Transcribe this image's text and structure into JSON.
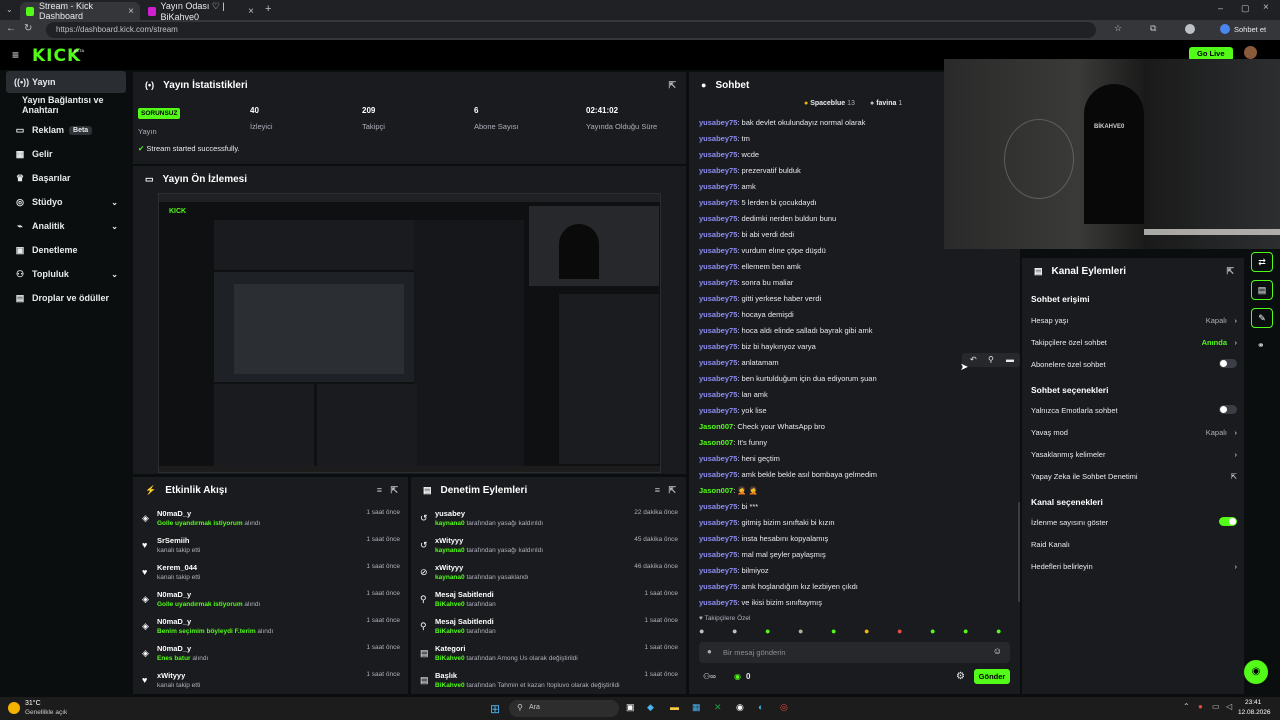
{
  "browser": {
    "tabs": [
      {
        "title": "Stream - Kick Dashboard",
        "color": "#53fc18"
      },
      {
        "title": "Yayın Odası ♡ | BiKahve0",
        "color": "#d01fd1"
      }
    ],
    "url": "https://dashboard.kick.com/stream",
    "profile_label": "Sohbet et"
  },
  "app": {
    "logo": "KICK",
    "logo_sup": "BETA",
    "go_live": "Go Live"
  },
  "sidebar": {
    "items": [
      {
        "label": "Yayın",
        "icon": "broadcast-icon"
      },
      {
        "label": "Yayın Bağlantısı ve Anahtarı",
        "icon": ""
      },
      {
        "label": "Reklam",
        "badge": "Beta",
        "icon": "ad-icon"
      },
      {
        "label": "Gelir",
        "icon": "money-icon"
      },
      {
        "label": "Başarılar",
        "icon": "trophy-icon"
      },
      {
        "label": "Stüdyo",
        "icon": "studio-icon"
      },
      {
        "label": "Analitik",
        "icon": "analytics-icon"
      },
      {
        "label": "Denetleme",
        "icon": "moderation-icon"
      },
      {
        "label": "Topluluk",
        "icon": "community-icon"
      },
      {
        "label": "Droplar ve ödüller",
        "icon": "drops-icon"
      }
    ]
  },
  "stats": {
    "title": "Yayın İstatistikleri",
    "status_badge": "SORUNSUZ",
    "status_label": "Yayın",
    "items": [
      {
        "value": "40",
        "label": "İzleyici"
      },
      {
        "value": "209",
        "label": "Takipçi"
      },
      {
        "value": "6",
        "label": "Abone Sayısı"
      },
      {
        "value": "02:41:02",
        "label": "Yayında Olduğu Süre"
      }
    ],
    "success": "Stream started successfully."
  },
  "preview": {
    "title": "Yayın Ön İzlemesi"
  },
  "activity": {
    "title": "Etkinlik Akışı",
    "rows": [
      {
        "name": "N0maD_y",
        "pre": "",
        "hl": "Golle uyandırmak istiyorum",
        "post": " alındı",
        "time": "1 saat önce",
        "icon": "◈"
      },
      {
        "name": "SrSemiih",
        "pre": "kanalı takip etti",
        "hl": "",
        "post": "",
        "time": "1 saat önce",
        "icon": "♥"
      },
      {
        "name": "Kerem_044",
        "pre": "kanalı takip etti",
        "hl": "",
        "post": "",
        "time": "1 saat önce",
        "icon": "♥"
      },
      {
        "name": "N0maD_y",
        "pre": "",
        "hl": "Golle uyandırmak istiyorum",
        "post": " alındı",
        "time": "1 saat önce",
        "icon": "◈"
      },
      {
        "name": "N0maD_y",
        "pre": "",
        "hl": "Benim seçimim böyleydi F.terim",
        "post": " alındı",
        "time": "1 saat önce",
        "icon": "◈"
      },
      {
        "name": "N0maD_y",
        "pre": "",
        "hl": "Enes batur",
        "post": " alındı",
        "time": "1 saat önce",
        "icon": "◈"
      },
      {
        "name": "xWityyy",
        "pre": "kanalı takip etti",
        "hl": "",
        "post": "",
        "time": "1 saat önce",
        "icon": "♥"
      }
    ]
  },
  "modlog": {
    "title": "Denetim Eylemleri",
    "rows": [
      {
        "name": "yusabey",
        "hl": "kaynana0",
        "post": " tarafından yasağı kaldırıldı",
        "time": "22 dakika önce",
        "icon": "↺"
      },
      {
        "name": "xWityyy",
        "hl": "kaynana0",
        "post": " tarafından yasağı kaldırıldı",
        "time": "45 dakika önce",
        "icon": "↺"
      },
      {
        "name": "xWityyy",
        "hl": "kaynana0",
        "post": " tarafından yasaklandı",
        "time": "46 dakika önce",
        "icon": "⊘"
      },
      {
        "name": "Mesaj Sabitlendi",
        "hl": "BiKahve0",
        "post": " tarafından",
        "time": "1 saat önce",
        "icon": "⚲"
      },
      {
        "name": "Mesaj Sabitlendi",
        "hl": "BiKahve0",
        "post": " tarafından",
        "time": "1 saat önce",
        "icon": "⚲"
      },
      {
        "name": "Kategori",
        "hl": "BiKahve0",
        "post": " tarafından Among Us olarak değiştirildi",
        "time": "1 saat önce",
        "icon": "▤"
      },
      {
        "name": "Başlık",
        "hl": "BiKahve0",
        "post": " tarafından Tahmin et kazan !topluvo olarak değiştirildi",
        "time": "1 saat önce",
        "icon": "▤"
      }
    ]
  },
  "chat": {
    "title": "Sohbet",
    "top_chips": [
      {
        "name": "Spaceblue",
        "count": "13"
      },
      {
        "name": "favina",
        "count": "1"
      }
    ],
    "messages": [
      {
        "user": "yusabey75",
        "text": "bak devlet okulundayız normal olarak",
        "color": "#8d8df7"
      },
      {
        "user": "yusabey75",
        "text": "tm",
        "color": "#8d8df7"
      },
      {
        "user": "yusabey75",
        "text": "wcde",
        "color": "#8d8df7"
      },
      {
        "user": "yusabey75",
        "text": "prezervatif bulduk",
        "color": "#8d8df7"
      },
      {
        "user": "yusabey75",
        "text": "amk",
        "color": "#8d8df7"
      },
      {
        "user": "yusabey75",
        "text": "5 lerden bi çocukdaydı",
        "color": "#8d8df7"
      },
      {
        "user": "yusabey75",
        "text": "dedimki nerden buldun bunu",
        "color": "#8d8df7"
      },
      {
        "user": "yusabey75",
        "text": "bi abi verdi dedi",
        "color": "#8d8df7"
      },
      {
        "user": "yusabey75",
        "text": "vurdum elıne çöpe düşdü",
        "color": "#8d8df7"
      },
      {
        "user": "yusabey75",
        "text": "ellemem ben amk",
        "color": "#8d8df7"
      },
      {
        "user": "yusabey75",
        "text": "sonra bu maliar",
        "color": "#8d8df7"
      },
      {
        "user": "yusabey75",
        "text": "gitti yerkese haber verdi",
        "color": "#8d8df7"
      },
      {
        "user": "yusabey75",
        "text": "hocaya demişdi",
        "color": "#8d8df7"
      },
      {
        "user": "yusabey75",
        "text": "hoca aldı elinde salladı bayrak gibi amk",
        "color": "#8d8df7"
      },
      {
        "user": "yusabey75",
        "text": "biz bi haykırıyoz varya",
        "color": "#8d8df7"
      },
      {
        "user": "yusabey75",
        "text": "anlatamam",
        "color": "#8d8df7"
      },
      {
        "user": "yusabey75",
        "text": "ben kurtulduğum için dua ediyorum şuan",
        "color": "#8d8df7"
      },
      {
        "user": "yusabey75",
        "text": "lan amk",
        "color": "#8d8df7"
      },
      {
        "user": "yusabey75",
        "text": "yok lise",
        "color": "#8d8df7"
      },
      {
        "user": "Jason007",
        "text": "Check your WhatsApp bro",
        "color": "#53fc18"
      },
      {
        "user": "Jason007",
        "text": "It's funny",
        "color": "#53fc18"
      },
      {
        "user": "yusabey75",
        "text": "heni geçtim",
        "color": "#8d8df7"
      },
      {
        "user": "yusabey75",
        "text": "amk bekle bekle asıl bombaya gelmedim",
        "color": "#8d8df7"
      },
      {
        "user": "Jason007",
        "text": "🤦 🤦",
        "color": "#53fc18"
      },
      {
        "user": "yusabey75",
        "text": "bi ***",
        "color": "#8d8df7"
      },
      {
        "user": "yusabey75",
        "text": "gitmiş bizim sınıftaki bi kızın",
        "color": "#8d8df7"
      },
      {
        "user": "yusabey75",
        "text": "insta hesabını kopyalamış",
        "color": "#8d8df7"
      },
      {
        "user": "yusabey75",
        "text": "mal mal şeyler paylaşmış",
        "color": "#8d8df7"
      },
      {
        "user": "yusabey75",
        "text": "bilmiyoz",
        "color": "#8d8df7"
      },
      {
        "user": "yusabey75",
        "text": "amk hoşlandığım kız lezbiyen çıkdı",
        "color": "#8d8df7"
      },
      {
        "user": "yusabey75",
        "text": "ve ikisi bizim sınıftaymış",
        "color": "#8d8df7"
      }
    ],
    "followers_only_label": "Takipçilere Özel",
    "input_placeholder": "Bir mesaj gönderin",
    "points": "0",
    "send_label": "Gönder"
  },
  "channel_actions": {
    "title": "Kanal Eylemleri",
    "sections": [
      {
        "title": "Sohbet erişimi",
        "rows": [
          {
            "label": "Hesap yaşı",
            "value": "Kapalı",
            "kind": "chev"
          },
          {
            "label": "Takipçilere özel sohbet",
            "value": "Anında",
            "kind": "chev-green"
          },
          {
            "label": "Abonelere özel sohbet",
            "value": "",
            "kind": "toggle-off"
          }
        ]
      },
      {
        "title": "Sohbet seçenekleri",
        "rows": [
          {
            "label": "Yalnızca Emotlarla sohbet",
            "value": "",
            "kind": "toggle-off"
          },
          {
            "label": "Yavaş mod",
            "value": "Kapalı",
            "kind": "chev"
          },
          {
            "label": "Yasaklanmış kelimeler",
            "value": "",
            "kind": "chev"
          },
          {
            "label": "Yapay Zeka ile Sohbet Denetimi",
            "value": "",
            "kind": "ext"
          }
        ]
      },
      {
        "title": "Kanal seçenekleri",
        "rows": [
          {
            "label": "İzlenme sayısını göster",
            "value": "",
            "kind": "toggle-on"
          },
          {
            "label": "Raid Kanalı",
            "value": "",
            "kind": "none"
          },
          {
            "label": "Hedefleri belirleyin",
            "value": "",
            "kind": "chev"
          }
        ]
      }
    ]
  },
  "taskbar": {
    "weather_temp": "31°C",
    "weather_text": "Genellikle açık",
    "search_placeholder": "Ara",
    "time": "23:41",
    "date": "12.08.2026"
  }
}
